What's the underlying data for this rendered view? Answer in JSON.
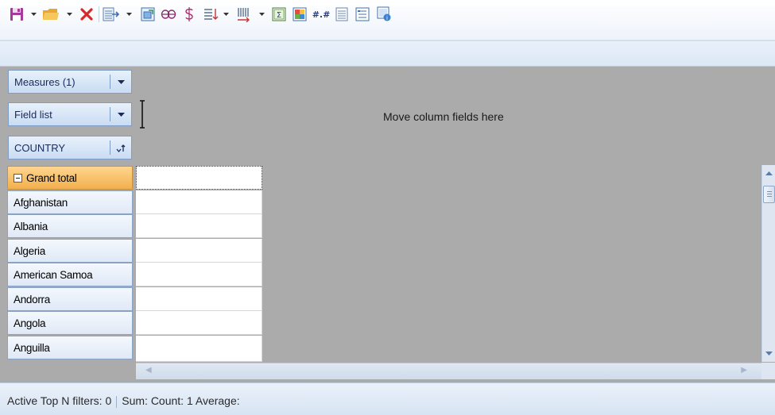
{
  "toolbar": {
    "icons": [
      "save-icon",
      "dropdown-arrow",
      "open-folder-icon",
      "dropdown-arrow",
      "delete-icon",
      "export-icon",
      "dropdown-arrow",
      "refresh-icon",
      "infinity-icon",
      "currency-icon",
      "sort-rows-icon",
      "dropdown-arrow",
      "sort-columns-icon",
      "dropdown-arrow",
      "totals-icon",
      "heatmap-icon",
      "number-format-icon",
      "fields-list-icon",
      "properties-icon",
      "options-icon"
    ],
    "colors": {
      "save": "#9b2d8f",
      "open": "#e8a733",
      "delete": "#d92a2a",
      "accent": "#3a6fb5"
    }
  },
  "pivot": {
    "measures_button": "Measures (1)",
    "fieldlist_button": "Field list",
    "country_button": "COUNTRY",
    "column_placeholder": "Move column fields here",
    "grand_total": "Grand total",
    "rows": [
      "Afghanistan",
      "Albania",
      "Algeria",
      "American Samoa",
      "Andorra",
      "Angola",
      "Anguilla"
    ]
  },
  "status": {
    "top_n": "Active Top N filters: 0",
    "summary": "Sum:  Count: 1 Average:"
  }
}
